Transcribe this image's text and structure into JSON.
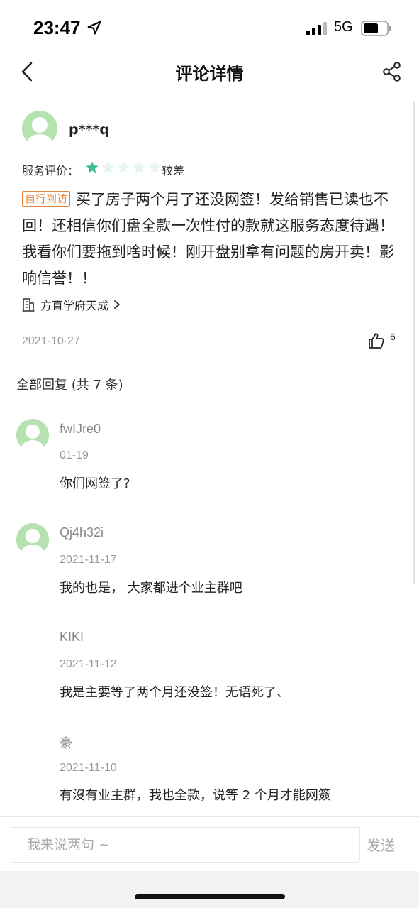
{
  "status_bar": {
    "time": "23:47",
    "network": "5G"
  },
  "nav": {
    "title": "评论详情"
  },
  "comment": {
    "username": "p***q",
    "rating_label": "服务评价：",
    "rating_stars": 1,
    "rating_max": 5,
    "rating_text": "较差",
    "tag": "自行到访",
    "text": "买了房子两个月了还没网签！发给销售已读也不回！还相信你们盘全款一次性付的款就这服务态度待遇！我看你们要拖到啥时候！刚开盘别拿有问题的房开卖！影响信誉！！",
    "project": "方直学府天成",
    "date": "2021-10-27",
    "likes": "6"
  },
  "replies_header": "全部回复 (共 7 条)",
  "replies": [
    {
      "user": "fwIJre0",
      "date": "01-19",
      "text": "你们网签了?"
    },
    {
      "user": "Qj4h32i",
      "date": "2021-11-17",
      "text": "我的也是， 大家都进个业主群吧"
    },
    {
      "user": "KIKI",
      "date": "2021-11-12",
      "text": "我是主要等了两个月还没签！无语死了、"
    },
    {
      "user": "豪",
      "date": "2021-11-10",
      "text": "有沒有业主群，我也全款，说等 2 个月才能网簽"
    }
  ],
  "input": {
    "placeholder": "我来说两句 ~",
    "send_label": "发送"
  },
  "colors": {
    "star_active": "#3dbd9a",
    "star_inactive": "#e6f5f0",
    "tag": "#e8833a",
    "avatar_bg": "#b6e1b1"
  },
  "icons": {
    "back": "chevron-left-icon",
    "share": "share-icon",
    "building": "building-icon",
    "like": "thumbs-up-icon"
  }
}
